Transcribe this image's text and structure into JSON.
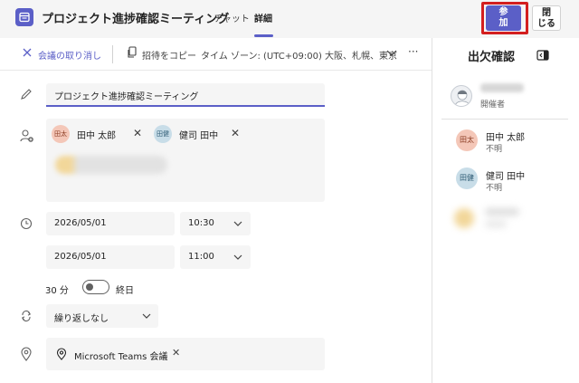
{
  "header": {
    "title": "プロジェクト進捗確認ミーティング",
    "tabs": [
      {
        "label": "チャット",
        "selected": false
      },
      {
        "label": "詳細",
        "selected": true
      }
    ],
    "join_label_1": "参",
    "join_label_2": "加",
    "close_label_1": "閉",
    "close_label_2": "じる",
    "accent_color": "#5b5fc7",
    "highlight_color": "#d31f1f"
  },
  "toolbar": {
    "cancel_label": "会議の取り消し",
    "copy_label": "招待をコピー",
    "timezone_label": "タイム ゾーン: (UTC+09:00) 大阪、札幌、東京",
    "more_label": "···"
  },
  "form": {
    "title_value": "プロジェクト進捗確認ミーティング",
    "attendees": [
      {
        "initials": "田太",
        "name": "田中 太郎"
      },
      {
        "initials": "田健",
        "name": "健司 田中"
      }
    ],
    "start_date": "2026/05/01",
    "start_time": "10:30",
    "end_date": "2026/05/01",
    "end_time": "11:00",
    "duration": "30 分",
    "all_day_label": "終日",
    "all_day_on": false,
    "recurrence": "繰り返しなし",
    "location": "Microsoft Teams 会議"
  },
  "attendance_panel": {
    "title": "出欠確認",
    "organizer_role": "開催者",
    "people": [
      {
        "initials": "田太",
        "name": "田中 太郎",
        "status": "不明"
      },
      {
        "initials": "田健",
        "name": "健司 田中",
        "status": "不明"
      }
    ]
  }
}
